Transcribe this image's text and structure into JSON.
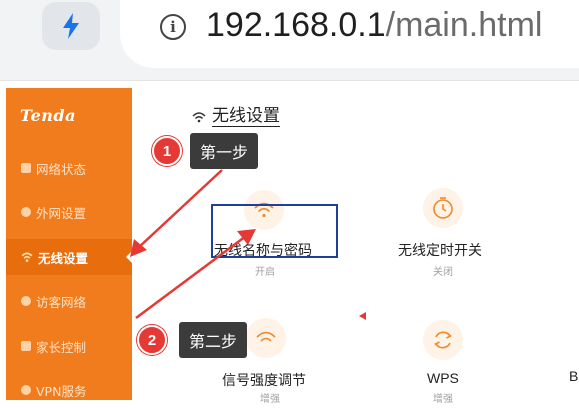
{
  "browser": {
    "url_host": "192.168.0.1",
    "url_path": "/main.html",
    "icons": {
      "lightning": "lightning-icon",
      "info": "info-icon"
    }
  },
  "sidebar": {
    "logo": "Tenda",
    "items": [
      {
        "label": "网络状态",
        "icon": "network-status-icon"
      },
      {
        "label": "外网设置",
        "icon": "globe-icon"
      },
      {
        "label": "无线设置",
        "icon": "wifi-icon",
        "active": true
      },
      {
        "label": "访客网络",
        "icon": "guest-icon"
      },
      {
        "label": "家长控制",
        "icon": "parental-icon"
      },
      {
        "label": "VPN服务",
        "icon": "vpn-icon"
      }
    ]
  },
  "main": {
    "title": "无线设置",
    "tiles": [
      {
        "label": "无线名称与密码",
        "status": "开启"
      },
      {
        "label": "无线定时开关",
        "status": "关闭"
      },
      {
        "label": "信号强度调节",
        "status": "增强"
      },
      {
        "label": "WPS",
        "status": "增强"
      }
    ],
    "partial_tile_label": "B"
  },
  "annotations": {
    "step1": {
      "number": "1",
      "text": "第一步"
    },
    "step2": {
      "number": "2",
      "text": "第二步"
    }
  },
  "colors": {
    "sidebar": "#f07c1e",
    "accent": "#f08a2c",
    "annotation_red": "#e53935",
    "highlight_blue": "#1f3f99"
  }
}
